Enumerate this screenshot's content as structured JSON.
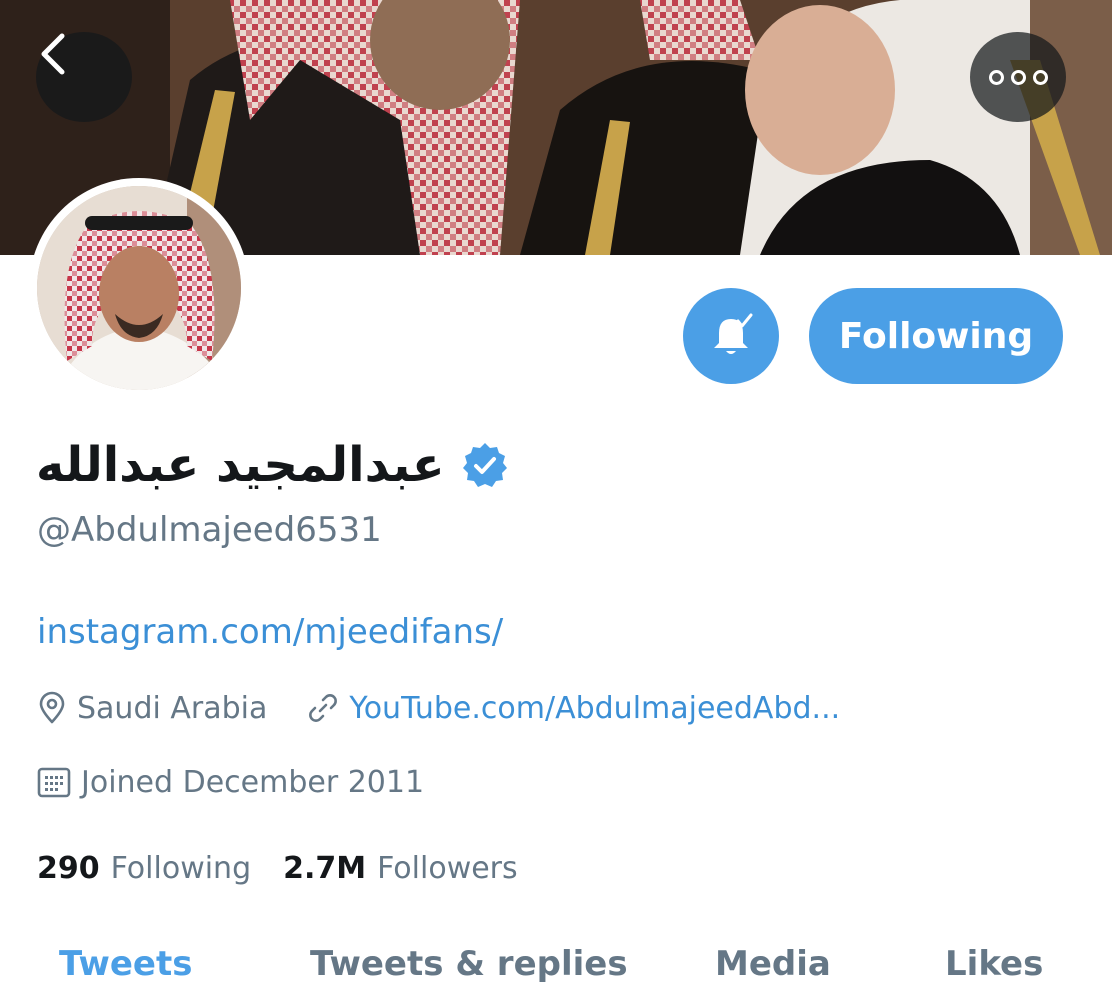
{
  "header": {
    "back_icon": "chevron-left-icon",
    "more_icon": "more-horizontal-icon"
  },
  "profile": {
    "display_name": "عبدالمجيد عبدالله",
    "verified": true,
    "handle": "@Abdulmajeed6531",
    "bio_link": "instagram.com/mjeedifans/",
    "location": "Saudi Arabia",
    "website": "YouTube.com/AbdulmajeedAbd...",
    "joined": "Joined December 2011",
    "following_count": "290",
    "following_label": "Following",
    "followers_count": "2.7M",
    "followers_label": "Followers"
  },
  "actions": {
    "notifications_icon": "bell-check-icon",
    "follow_label": "Following"
  },
  "tabs": [
    {
      "label": "Tweets",
      "active": true
    },
    {
      "label": "Tweets & replies",
      "active": false
    },
    {
      "label": "Media",
      "active": false
    },
    {
      "label": "Likes",
      "active": false
    }
  ],
  "colors": {
    "accent": "#4b9fe6",
    "link": "#3b8fd6",
    "secondary_text": "#657786",
    "primary_text": "#14171a"
  }
}
